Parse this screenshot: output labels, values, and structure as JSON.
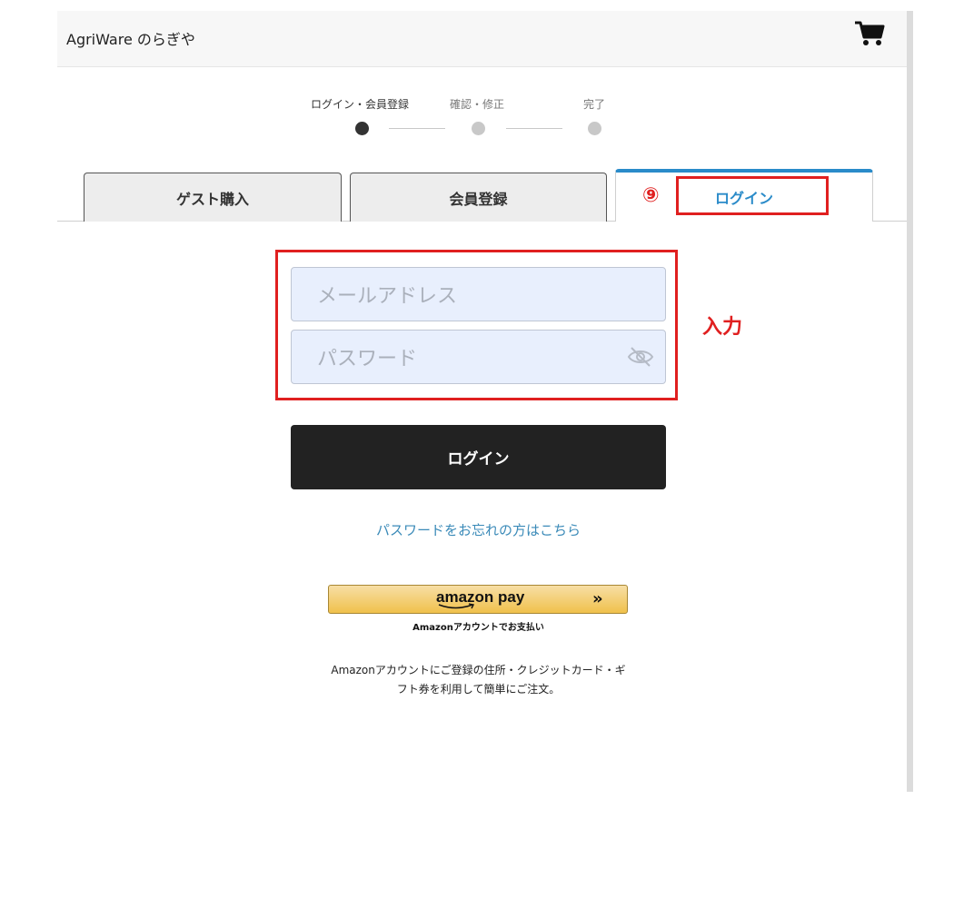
{
  "header": {
    "brand": "AgriWare のらぎや",
    "cart_icon": "cart-icon"
  },
  "steps": [
    {
      "label": "ログイン・会員登録",
      "active": true
    },
    {
      "label": "確認・修正",
      "active": false
    },
    {
      "label": "完了",
      "active": false
    }
  ],
  "tabs": [
    {
      "label": "ゲスト購入",
      "active": false
    },
    {
      "label": "会員登録",
      "active": false
    },
    {
      "label": "ログイン",
      "active": true
    }
  ],
  "annotations": {
    "step_number": "⑨",
    "input_note": "入力",
    "highlight_color": "#e02020"
  },
  "form": {
    "email_placeholder": "メールアドレス",
    "password_placeholder": "パスワード",
    "login_button": "ログイン",
    "forgot_link": "パスワードをお忘れの方はこちら"
  },
  "amazon": {
    "logo": "amazon pay",
    "caption": "Amazonアカウントでお支払い",
    "description": "Amazonアカウントにご登録の住所・クレジットカード・ギフト券を利用して簡単にご注文。"
  },
  "colors": {
    "accent": "#2a8bc9",
    "button": "#222222",
    "input_bg": "#e8effd"
  }
}
